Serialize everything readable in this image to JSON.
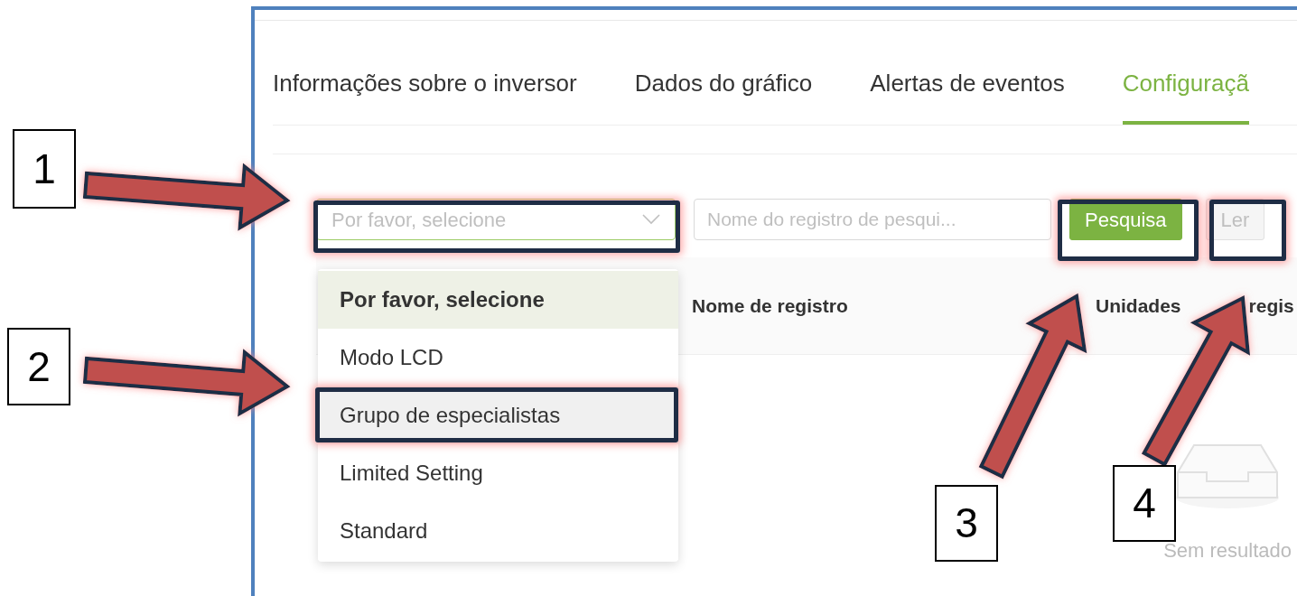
{
  "tabs": [
    {
      "label": "Informações sobre o inversor",
      "selected": false
    },
    {
      "label": "Dados do gráfico",
      "selected": false
    },
    {
      "label": "Alertas de eventos",
      "selected": false
    },
    {
      "label": "Configuraçã",
      "selected": true
    }
  ],
  "filter_bar": {
    "select": {
      "placeholder": "Por favor, selecione",
      "expanded": true
    },
    "search": {
      "placeholder": "Nome do registro de pesqui..."
    },
    "buttons": [
      {
        "label": "Pesquisa",
        "disabled": false
      },
      {
        "label": "Ler",
        "disabled": true
      }
    ]
  },
  "dropdown": {
    "options": [
      {
        "label": "Por favor, selecione",
        "selected": true,
        "hovered": false
      },
      {
        "label": "Modo LCD",
        "selected": false,
        "hovered": false
      },
      {
        "label": "Grupo de especialistas",
        "selected": false,
        "hovered": true
      },
      {
        "label": "Limited Setting",
        "selected": false,
        "hovered": false
      },
      {
        "label": "Standard",
        "selected": false,
        "hovered": false
      }
    ]
  },
  "table": {
    "columns": [
      {
        "parts": [
          "Nome de registro"
        ]
      },
      {
        "parts": [
          "Unidades",
          "regis"
        ]
      }
    ]
  },
  "empty_state": {
    "text": "Sem resultado"
  },
  "annotations": [
    {
      "number": "1"
    },
    {
      "number": "2"
    },
    {
      "number": "3"
    },
    {
      "number": "4"
    }
  ]
}
